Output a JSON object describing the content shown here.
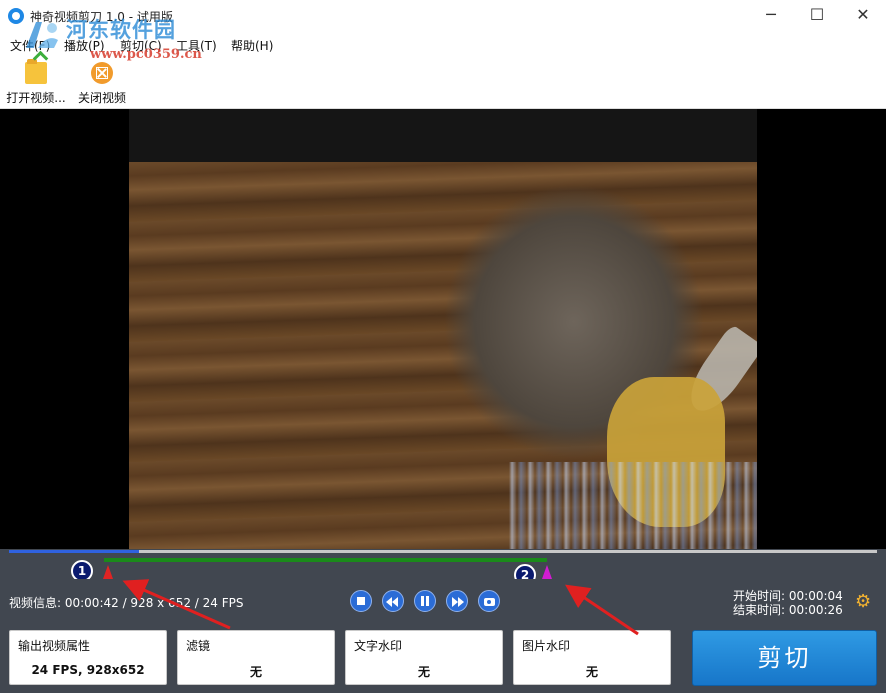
{
  "window": {
    "title": "神奇视频剪刀 1.0 - 试用版",
    "minimize_glyph": "─",
    "maximize_glyph": "☐",
    "close_glyph": "✕"
  },
  "watermark": {
    "site_name": "河东软件园",
    "url": "www.pc0359.cn"
  },
  "menu": [
    {
      "label": "文件(F)"
    },
    {
      "label": "播放(P)"
    },
    {
      "label": "剪切(C)"
    },
    {
      "label": "工具(T)"
    },
    {
      "label": "帮助(H)"
    }
  ],
  "toolbar": {
    "open_label": "打开视频...",
    "close_label": "关闭视频"
  },
  "timeline": {
    "played_fraction": 0.15,
    "selection_start_fraction": 0.11,
    "selection_end_fraction": 0.62,
    "badge_1": "1",
    "badge_2": "2"
  },
  "info": {
    "video_info": "视频信息: 00:00:42 / 928 x 652 / 24 FPS",
    "start_time_label": "开始时间:",
    "start_time": "00:00:04",
    "end_time_label": "结束时间:",
    "end_time": "00:00:26"
  },
  "options": {
    "output": {
      "title": "输出视频属性",
      "value": "24 FPS, 928x652"
    },
    "filter": {
      "title": "滤镜",
      "value": "无"
    },
    "text_watermark": {
      "title": "文字水印",
      "value": "无"
    },
    "image_watermark": {
      "title": "图片水印",
      "value": "无"
    }
  },
  "cut_button_label": "剪切",
  "icons": {
    "app": "app-icon",
    "open": "folder-open-icon",
    "close": "close-video-icon",
    "stop": "stop-icon",
    "rewind": "rewind-icon",
    "pause": "pause-icon",
    "forward": "forward-icon",
    "snapshot": "camera-icon",
    "settings": "gear-icon"
  },
  "colors": {
    "accent": "#2b6cd6",
    "panel": "#414750",
    "selection": "#1a8a1a",
    "start_marker": "#e02424",
    "end_marker": "#d21cd2",
    "cut_button": "#1f86d6",
    "annotation_arrow": "#e02020"
  }
}
